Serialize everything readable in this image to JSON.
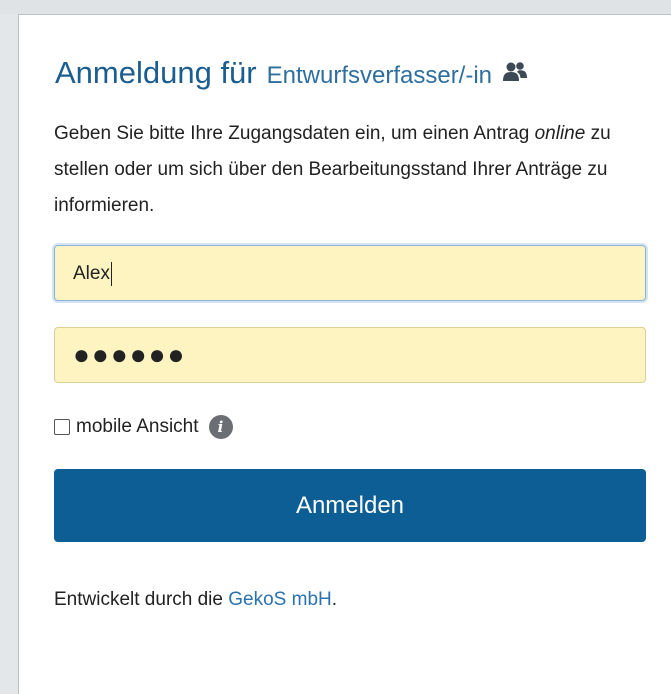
{
  "login": {
    "title_main": "Anmeldung für",
    "title_sub": "Entwurfsverfasser/-in",
    "title_icon": "users-icon",
    "intro_part1": "Geben Sie bitte Ihre Zugangsdaten ein, um einen Antrag ",
    "intro_emphasis": "online",
    "intro_part2": " zu stellen oder um sich über den Bearbeitungsstand Ihrer Anträge zu informieren.",
    "username_value": "Alex",
    "password_masked": "●●●●●●",
    "mobile_label": "mobile Ansicht",
    "mobile_checked": false,
    "info_icon": "info-icon",
    "submit_label": "Anmelden",
    "footer_prefix": "Entwickelt durch die ",
    "footer_link": "GekoS mbH",
    "footer_suffix": "."
  },
  "colors": {
    "accent": "#1c5d8f",
    "button": "#0c5e95",
    "field_bg": "#fdf4c2",
    "link": "#2a72b0"
  }
}
